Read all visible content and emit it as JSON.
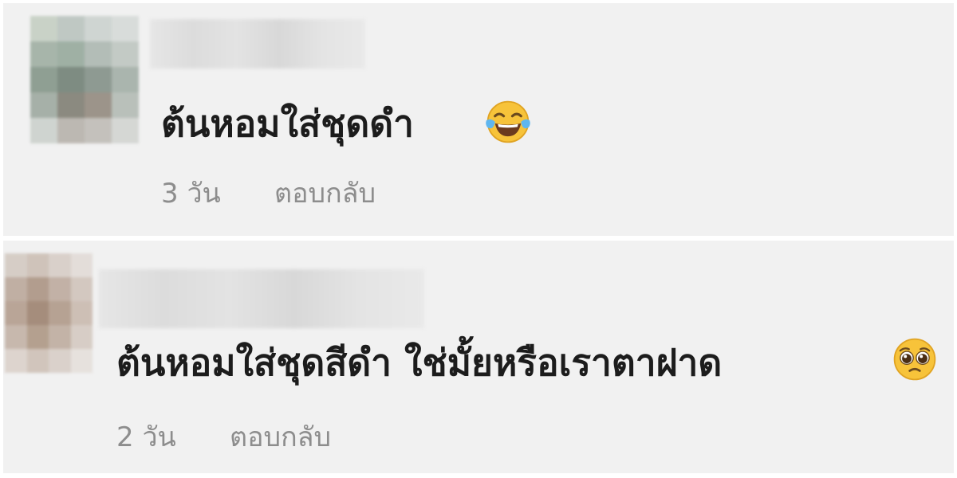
{
  "comments": [
    {
      "text": "ต้นหอมใส่ชุดดำ",
      "emoji": "face-with-tears-of-joy-icon",
      "time": "3 วัน",
      "reply_label": "ตอบกลับ"
    },
    {
      "text": "ต้นหอมใส่ชุดสีดำ ใช่มั้ยหรือเราตาฝาด",
      "emoji": "pleading-face-icon",
      "time": "2 วัน",
      "reply_label": "ตอบกลับ"
    }
  ],
  "colors": {
    "comment_bg": "#f1f1f1",
    "text": "#1c1c1c",
    "meta_text": "#8d8d8d"
  }
}
